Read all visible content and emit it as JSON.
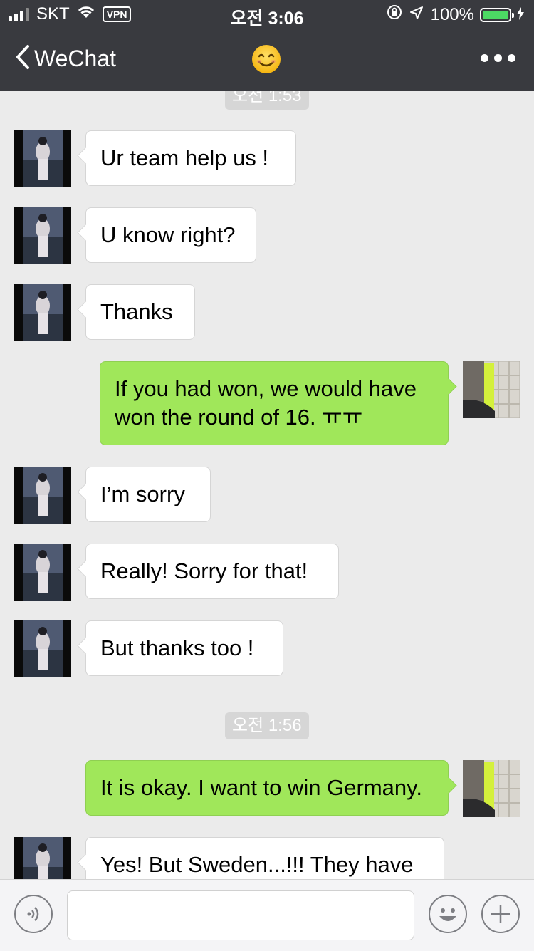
{
  "status_bar": {
    "carrier": "SKT",
    "vpn_label": "VPN",
    "time": "오전 3:06",
    "battery_percent": "100%",
    "battery_level": 1.0,
    "accent_green": "#4cd964"
  },
  "nav": {
    "back_label": "WeChat",
    "title_icon": "smiling-face-emoji",
    "more_icon": "more-dots-icon",
    "bar_color": "#393a3f"
  },
  "chat": {
    "timestamps": [
      "오전 1:53",
      "오전 1:56"
    ],
    "messages": [
      {
        "direction": "in",
        "text": "Ur team help us !"
      },
      {
        "direction": "in",
        "text": "U know right?"
      },
      {
        "direction": "in",
        "text": "Thanks"
      },
      {
        "direction": "out",
        "text": "If you had won, we would have won the round of 16. ㅠㅠ"
      },
      {
        "direction": "in",
        "text": "I’m sorry"
      },
      {
        "direction": "in",
        "text": "Really! Sorry for that!"
      },
      {
        "direction": "in",
        "text": "But thanks too !"
      },
      {
        "direction": "out",
        "text": "It is okay. I want to win Germany."
      },
      {
        "direction": "in",
        "text": "Yes! But Sweden...!!! They have"
      }
    ],
    "incoming_bubble_color": "#ffffff",
    "outgoing_bubble_color": "#a0e75a"
  },
  "input_bar": {
    "voice_icon": "voice-input-icon",
    "emoji_icon": "emoji-smiley-icon",
    "add_icon": "plus-icon",
    "text_value": ""
  }
}
